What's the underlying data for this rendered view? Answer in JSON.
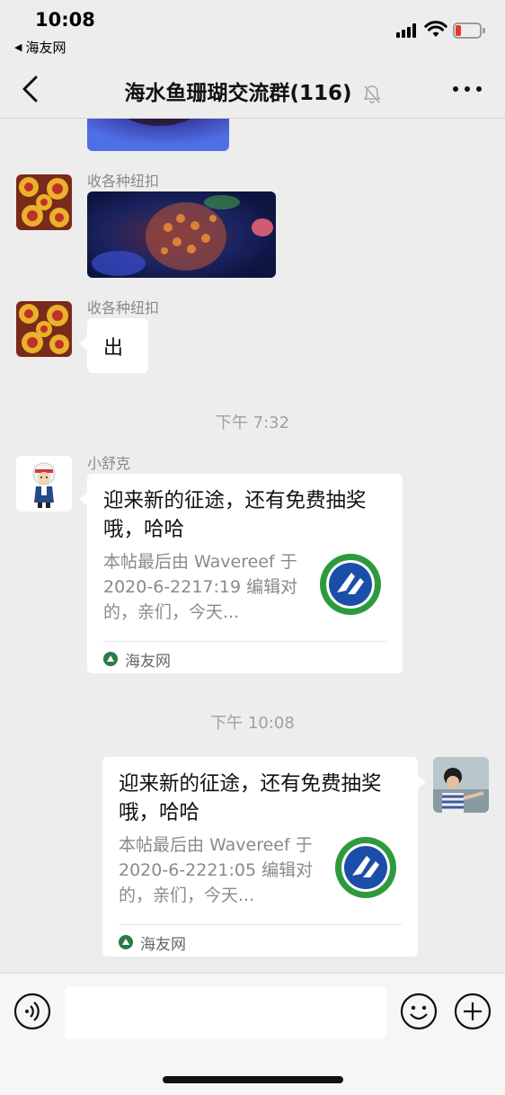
{
  "status_bar": {
    "time": "10:08",
    "back_app": "海友网",
    "battery_color": "#e8372e"
  },
  "nav": {
    "title": "海水鱼珊瑚交流群(116)",
    "back_icon": "chevron-left-icon",
    "mute_icon": "bell-muted-icon",
    "more_icon": "more-dots-icon"
  },
  "messages": [
    {
      "type": "image",
      "direction": "in",
      "sender": "",
      "avatar": "coral-avatar"
    },
    {
      "type": "image",
      "direction": "in",
      "sender": "收各种纽扣",
      "avatar": "coral-avatar"
    },
    {
      "type": "text",
      "direction": "in",
      "sender": "收各种纽扣",
      "text": "出",
      "avatar": "coral-avatar"
    },
    {
      "type": "timestamp",
      "text": "下午 7:32"
    },
    {
      "type": "card",
      "direction": "in",
      "sender": "小舒克",
      "avatar": "cartoon-pilot-avatar",
      "title": "迎来新的征途，还有免费抽奖哦，哈哈",
      "desc": "本帖最后由 Wavereef 于 2020-6-2217:19 编辑对的，亲们，今天...",
      "source": "海友网"
    },
    {
      "type": "timestamp",
      "text": "下午 10:08"
    },
    {
      "type": "card",
      "direction": "out",
      "avatar": "child-avatar",
      "title": "迎来新的征途，还有免费抽奖哦，哈哈",
      "desc": "本帖最后由 Wavereef 于 2020-6-2221:05 编辑对的，亲们，今天...",
      "source": "海友网"
    }
  ],
  "input_bar": {
    "voice_icon": "voice-icon",
    "emoji_icon": "emoji-icon",
    "plus_icon": "plus-icon",
    "input_value": ""
  },
  "colors": {
    "background": "#ededed",
    "bubble": "#ffffff",
    "timestamp": "#a0a0a0",
    "sender": "#8a8a8a",
    "logo_green": "#2f9a3d",
    "logo_blue": "#1a4ea8"
  }
}
